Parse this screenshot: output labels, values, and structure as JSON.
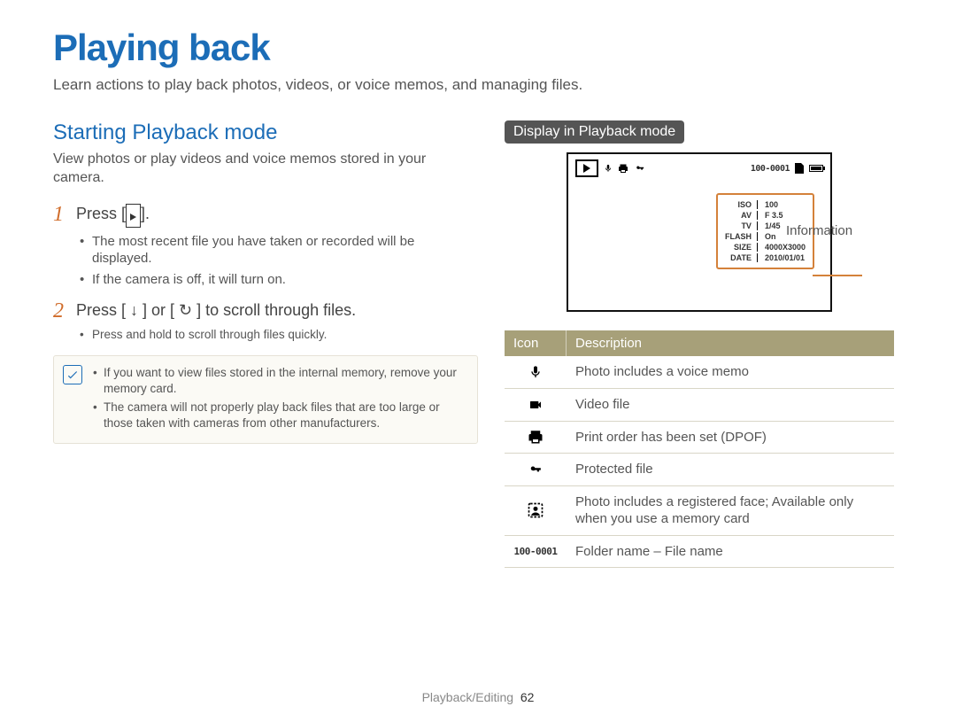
{
  "page": {
    "title": "Playing back",
    "subtitle": "Learn actions to play back photos, videos, or voice memos, and managing files.",
    "footer_section": "Playback/Editing",
    "footer_page": "62"
  },
  "left": {
    "heading": "Starting Playback mode",
    "desc": "View photos or play videos and voice memos stored in your camera.",
    "steps": [
      {
        "num": "1",
        "text_prefix": "Press [",
        "text_suffix": "].",
        "bullets": [
          "The most recent file you have taken or recorded will be displayed.",
          "If the camera is off, it will turn on."
        ]
      },
      {
        "num": "2",
        "text": "Press [ ↓ ] or [ ↻ ] to scroll through files.",
        "bullets_sm": [
          "Press and hold to scroll through files quickly."
        ]
      }
    ],
    "notes": [
      "If you want to view files stored in the internal memory, remove your memory card.",
      "The camera will not properly play back files that are too large or those taken with cameras from other manufacturers."
    ]
  },
  "right": {
    "pill": "Display in Playback mode",
    "folder_file": "100-0001",
    "info_label": "Information",
    "info_rows": [
      {
        "k": "ISO",
        "v": "100"
      },
      {
        "k": "AV",
        "v": "F 3.5"
      },
      {
        "k": "TV",
        "v": "1/45"
      },
      {
        "k": "FLASH",
        "v": "On"
      },
      {
        "k": "SIZE",
        "v": "4000X3000"
      },
      {
        "k": "DATE",
        "v": "2010/01/01"
      }
    ],
    "table_header": {
      "icon": "Icon",
      "desc": "Description"
    },
    "table_rows": [
      {
        "icon": "mic",
        "desc": "Photo includes a voice memo"
      },
      {
        "icon": "videocam",
        "desc": "Video file"
      },
      {
        "icon": "printer",
        "desc": "Print order has been set (DPOF)"
      },
      {
        "icon": "key",
        "desc": "Protected file"
      },
      {
        "icon": "face",
        "desc": "Photo includes a registered face; Available only when you use a memory card"
      },
      {
        "icon": "folderfile",
        "desc": "Folder name – File name"
      }
    ]
  }
}
